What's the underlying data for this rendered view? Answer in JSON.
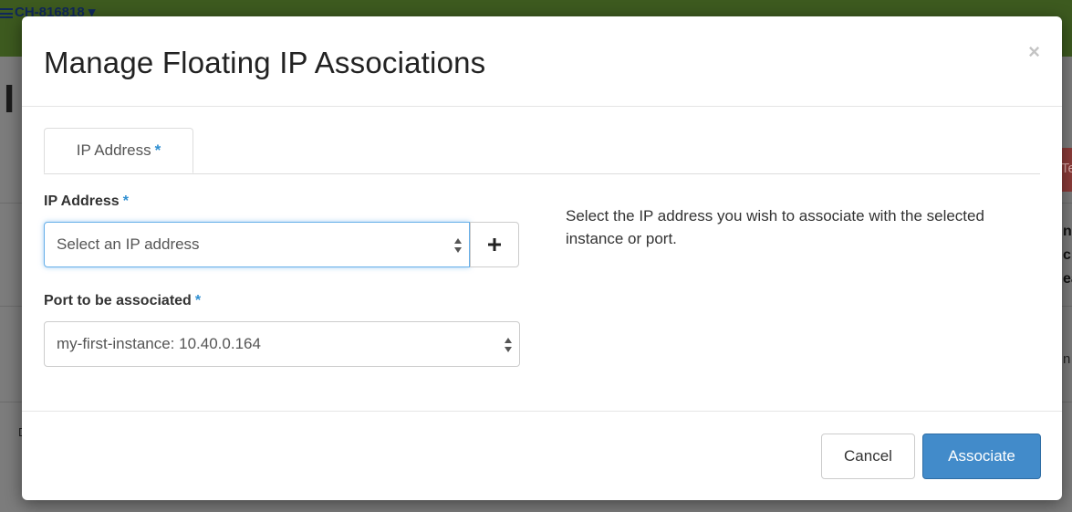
{
  "background": {
    "project_label": "CH-816818 ▾",
    "heading_partial": "I",
    "red_button_partial": "Te",
    "side_letters": [
      "n",
      "c",
      "ea",
      "n"
    ],
    "row_letter": "D"
  },
  "modal": {
    "title": "Manage Floating IP Associations",
    "close_symbol": "×",
    "tabs": [
      {
        "label": "IP Address",
        "required": "*"
      }
    ],
    "fields": {
      "ip_address": {
        "label": "IP Address",
        "required": "*",
        "selected": "Select an IP address"
      },
      "port": {
        "label": "Port to be associated",
        "required": "*",
        "selected": "my-first-instance: 10.40.0.164"
      }
    },
    "add_button_icon": "plus-icon",
    "help_text": "Select the IP address you wish to associate with the selected instance or port.",
    "buttons": {
      "cancel": "Cancel",
      "associate": "Associate"
    }
  },
  "colors": {
    "primary": "#428bca",
    "required_star": "#2f8fd1",
    "focus_border": "#66afe9"
  }
}
